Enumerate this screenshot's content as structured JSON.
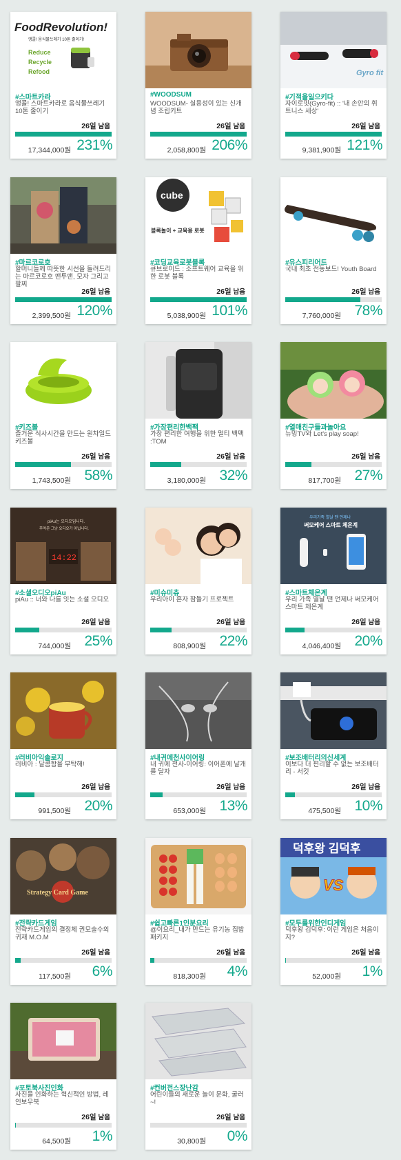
{
  "colors": {
    "accent": "#13a88c",
    "background": "#e6ebea",
    "bar_track": "#e2e2e2"
  },
  "days_unit": "남음",
  "thumb_texts": {
    "food_title": "FoodRevolution!",
    "food_sub": "앵콜! 음식물쓰레기 10톤 줄이기!",
    "food_r1": "Reduce",
    "food_r2": "Recycle",
    "food_r3": "Refood",
    "gyro_logo": "Gyro fit",
    "cube_logo": "cube",
    "cube_sub": "블록놀이 + 교육용 로봇",
    "piau_caption": "piAu는 오디오입니다.",
    "piau_sub": "추억은 그냥 오디오가 아닙니다.",
    "piau_clock": "14:22",
    "therm_caption": "우리가족 열날 땐 언제나",
    "therm_title": "써모케어 스마트 체온계",
    "card_game_title": "Strategy Card Game",
    "duck_title": "덕후왕 김덕후",
    "vs": "VS"
  },
  "cards": [
    {
      "tag": "#스마트카라",
      "desc": "앵콜! 스마트카라로 음식물쓰레기 10톤 줄이기",
      "days": "26일",
      "amount": "17,344,000원",
      "percent": "231%",
      "progress": 1.0,
      "thumb": "food"
    },
    {
      "tag": "#WOODSUM",
      "desc": "WOODSUM- 실용성이 있는 신개념 조립키트",
      "days": "26일",
      "amount": "2,058,800원",
      "percent": "206%",
      "progress": 1.0,
      "thumb": "camera"
    },
    {
      "tag": "#기적을일으키다",
      "desc": "자이로핏(Gyro-fit) :: '내 손안의 휘트니스 세상'",
      "days": "26일",
      "amount": "9,381,900원",
      "percent": "121%",
      "progress": 1.0,
      "thumb": "gyro"
    },
    {
      "tag": "#마르코로호",
      "desc": "할머니들께 따뜻한 시선을 돌려드리는 마르코로호 맨투맨, 모자 그리고 팔찌",
      "days": "26일",
      "amount": "2,399,500원",
      "percent": "120%",
      "progress": 1.0,
      "thumb": "couple"
    },
    {
      "tag": "#코딩교육로봇블록",
      "desc": "큐브로이드 : 소프트웨어 교육을 위한 로봇 블록",
      "days": "26일",
      "amount": "5,038,900원",
      "percent": "101%",
      "progress": 1.0,
      "thumb": "robot"
    },
    {
      "tag": "#유스피리어드",
      "desc": "국내 최초 전동보드! Youth Board",
      "days": "26일",
      "amount": "7,760,000원",
      "percent": "78%",
      "progress": 0.78,
      "thumb": "board"
    },
    {
      "tag": "#키즈볼",
      "desc": "즐거운 식사시간을 만드는 원차일드 키즈볼",
      "days": "26일",
      "amount": "1,743,500원",
      "percent": "58%",
      "progress": 0.58,
      "thumb": "bowl"
    },
    {
      "tag": "#가장편리한백팩",
      "desc": "가장 편리한 여행을 위한 멀티 백팩 :TOM",
      "days": "26일",
      "amount": "3,180,000원",
      "percent": "32%",
      "progress": 0.32,
      "thumb": "backpack"
    },
    {
      "tag": "#열매친구들과놀아요",
      "desc": "뉴밍TV와 Let's play soap!",
      "days": "26일",
      "amount": "817,700원",
      "percent": "27%",
      "progress": 0.27,
      "thumb": "soap"
    },
    {
      "tag": "#소셜오디오piAu",
      "desc": "piAu :: 너와 나를 잇는 소셜 오디오",
      "days": "26일",
      "amount": "744,000원",
      "percent": "25%",
      "progress": 0.25,
      "thumb": "audio"
    },
    {
      "tag": "#미슈미츄",
      "desc": "우리아이 혼자 잠들기 프로젝트",
      "days": "26일",
      "amount": "808,900원",
      "percent": "22%",
      "progress": 0.22,
      "thumb": "family"
    },
    {
      "tag": "#스마트체온계",
      "desc": "우리 가족 열날 땐 언제나 써모케어 스마트 체온계",
      "days": "26일",
      "amount": "4,046,400원",
      "percent": "20%",
      "progress": 0.2,
      "thumb": "thermo"
    },
    {
      "tag": "#러비아익솔로지",
      "desc": "러비아 : 달콤함을 부탁해!",
      "days": "26일",
      "amount": "991,500원",
      "percent": "20%",
      "progress": 0.2,
      "thumb": "tea"
    },
    {
      "tag": "#내귀에천사이어링",
      "desc": "내 귀에 천사-이어링: 이어폰에 날개를 달자",
      "days": "26일",
      "amount": "653,000원",
      "percent": "13%",
      "progress": 0.13,
      "thumb": "earphone"
    },
    {
      "tag": "#보조배터리의신세계",
      "desc": "이보다 더 편리할 수 없는 보조배터리 - 서킷",
      "days": "26일",
      "amount": "475,500원",
      "percent": "10%",
      "progress": 0.1,
      "thumb": "battery"
    },
    {
      "tag": "#전략카드게임",
      "desc": "전략카드게임의 결정체 권모술수의 귀재 M.O.M",
      "days": "26일",
      "amount": "117,500원",
      "percent": "6%",
      "progress": 0.06,
      "thumb": "cards"
    },
    {
      "tag": "#쉽고빠른1인분요리",
      "desc": "@이요리_내가 만드는 유기농 집밥 패키지",
      "days": "26일",
      "amount": "818,300원",
      "percent": "4%",
      "progress": 0.04,
      "thumb": "cooking"
    },
    {
      "tag": "#모두를위한인디게임",
      "desc": "덕후왕 김덕후: 이런 게임은 처음이지?",
      "days": "26일",
      "amount": "52,000원",
      "percent": "1%",
      "progress": 0.01,
      "thumb": "game"
    },
    {
      "tag": "#포토북사진인화",
      "desc": "사진을 인화하는 혁신적인 방법, 레인보우북",
      "days": "26일",
      "amount": "64,500원",
      "percent": "1%",
      "progress": 0.01,
      "thumb": "photobook"
    },
    {
      "tag": "#컨버전스장난감",
      "desc": "어린이들의 새로운 놀이 문화, 굴러~!",
      "days": "26일",
      "amount": "30,800원",
      "percent": "0%",
      "progress": 0.0,
      "thumb": "toy"
    }
  ]
}
